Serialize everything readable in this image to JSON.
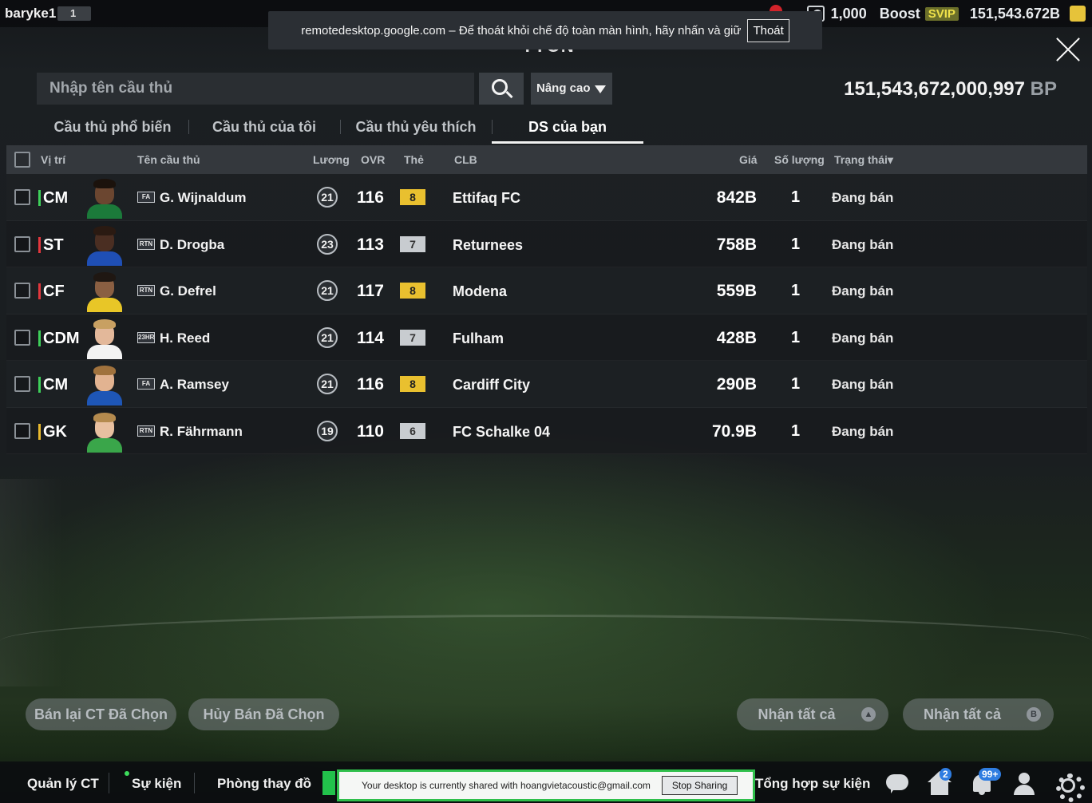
{
  "topbar": {
    "username": "baryke1",
    "level": "1",
    "tickets": "1,000",
    "boost_label": "Boost",
    "svip_label": "SVIP",
    "bp_balance": "151,543.672B"
  },
  "remote_banner": {
    "text": "remotedesktop.google.com – Để thoát khỏi chế độ toàn màn hình, hãy nhấn và giữ",
    "exit_label": "Thoát"
  },
  "page_title": "TTCN",
  "search": {
    "placeholder": "Nhập tên cầu thủ",
    "advanced_label": "Nâng cao"
  },
  "bp_total": {
    "value": "151,543,672,000,997",
    "unit": "BP"
  },
  "tabs": [
    {
      "label": "Cầu thủ phổ biến"
    },
    {
      "label": "Cầu thủ của tôi"
    },
    {
      "label": "Cầu thủ yêu thích"
    },
    {
      "label": "DS của bạn",
      "active": true
    }
  ],
  "table": {
    "headers": {
      "position": "Vị trí",
      "name": "Tên cầu thủ",
      "wage": "Lương",
      "ovr": "OVR",
      "card": "Thẻ",
      "club": "CLB",
      "price": "Giá",
      "quantity": "Số lượng",
      "status": "Trạng thái▾"
    },
    "rows": [
      {
        "position": "CM",
        "pos_color": "#3ecf5a",
        "season": "FA",
        "name": "G. Wijnaldum",
        "wage": "21",
        "ovr": "116",
        "card": "8",
        "card_type": "gold",
        "club": "Ettifaq FC",
        "price": "842B",
        "quantity": "1",
        "status": "Đang bán"
      },
      {
        "position": "ST",
        "pos_color": "#e2373d",
        "season": "RTN",
        "name": "D. Drogba",
        "wage": "23",
        "ovr": "113",
        "card": "7",
        "card_type": "silver",
        "club": "Returnees",
        "price": "758B",
        "quantity": "1",
        "status": "Đang bán"
      },
      {
        "position": "CF",
        "pos_color": "#e2373d",
        "season": "RTN",
        "name": "G. Defrel",
        "wage": "21",
        "ovr": "117",
        "card": "8",
        "card_type": "gold",
        "club": "Modena",
        "price": "559B",
        "quantity": "1",
        "status": "Đang bán"
      },
      {
        "position": "CDM",
        "pos_color": "#3ecf5a",
        "season": "23HR",
        "name": "H. Reed",
        "wage": "21",
        "ovr": "114",
        "card": "7",
        "card_type": "silver",
        "club": "Fulham",
        "price": "428B",
        "quantity": "1",
        "status": "Đang bán"
      },
      {
        "position": "CM",
        "pos_color": "#3ecf5a",
        "season": "FA",
        "name": "A. Ramsey",
        "wage": "21",
        "ovr": "116",
        "card": "8",
        "card_type": "gold",
        "club": "Cardiff City",
        "price": "290B",
        "quantity": "1",
        "status": "Đang bán"
      },
      {
        "position": "GK",
        "pos_color": "#e8b92e",
        "season": "RTN",
        "name": "R. Fährmann",
        "wage": "19",
        "ovr": "110",
        "card": "6",
        "card_type": "silver",
        "club": "FC Schalke 04",
        "price": "70.9B",
        "quantity": "1",
        "status": "Đang bán"
      }
    ]
  },
  "actions": {
    "resell_label": "Bán lại CT Đã Chọn",
    "cancel_label": "Hủy Bán Đã Chọn",
    "claim_all_label_1": "Nhận tất cả",
    "claim_all_label_2": "Nhận tất cả"
  },
  "bottom_nav": {
    "manage": "Quản lý CT",
    "events": "Sự kiện",
    "locker": "Phòng thay đồ",
    "event_summary": "Tổng hợp sự kiện",
    "home_badge": "2",
    "bell_badge": "99+"
  },
  "share_banner": {
    "text": "Your desktop is currently shared with hoangvietacoustic@gmail.com",
    "stop_label": "Stop Sharing"
  },
  "colors": {
    "accent_green": "#2fbf4b",
    "gold_card": "#e9c02f",
    "badge_blue": "#2f7de1"
  }
}
